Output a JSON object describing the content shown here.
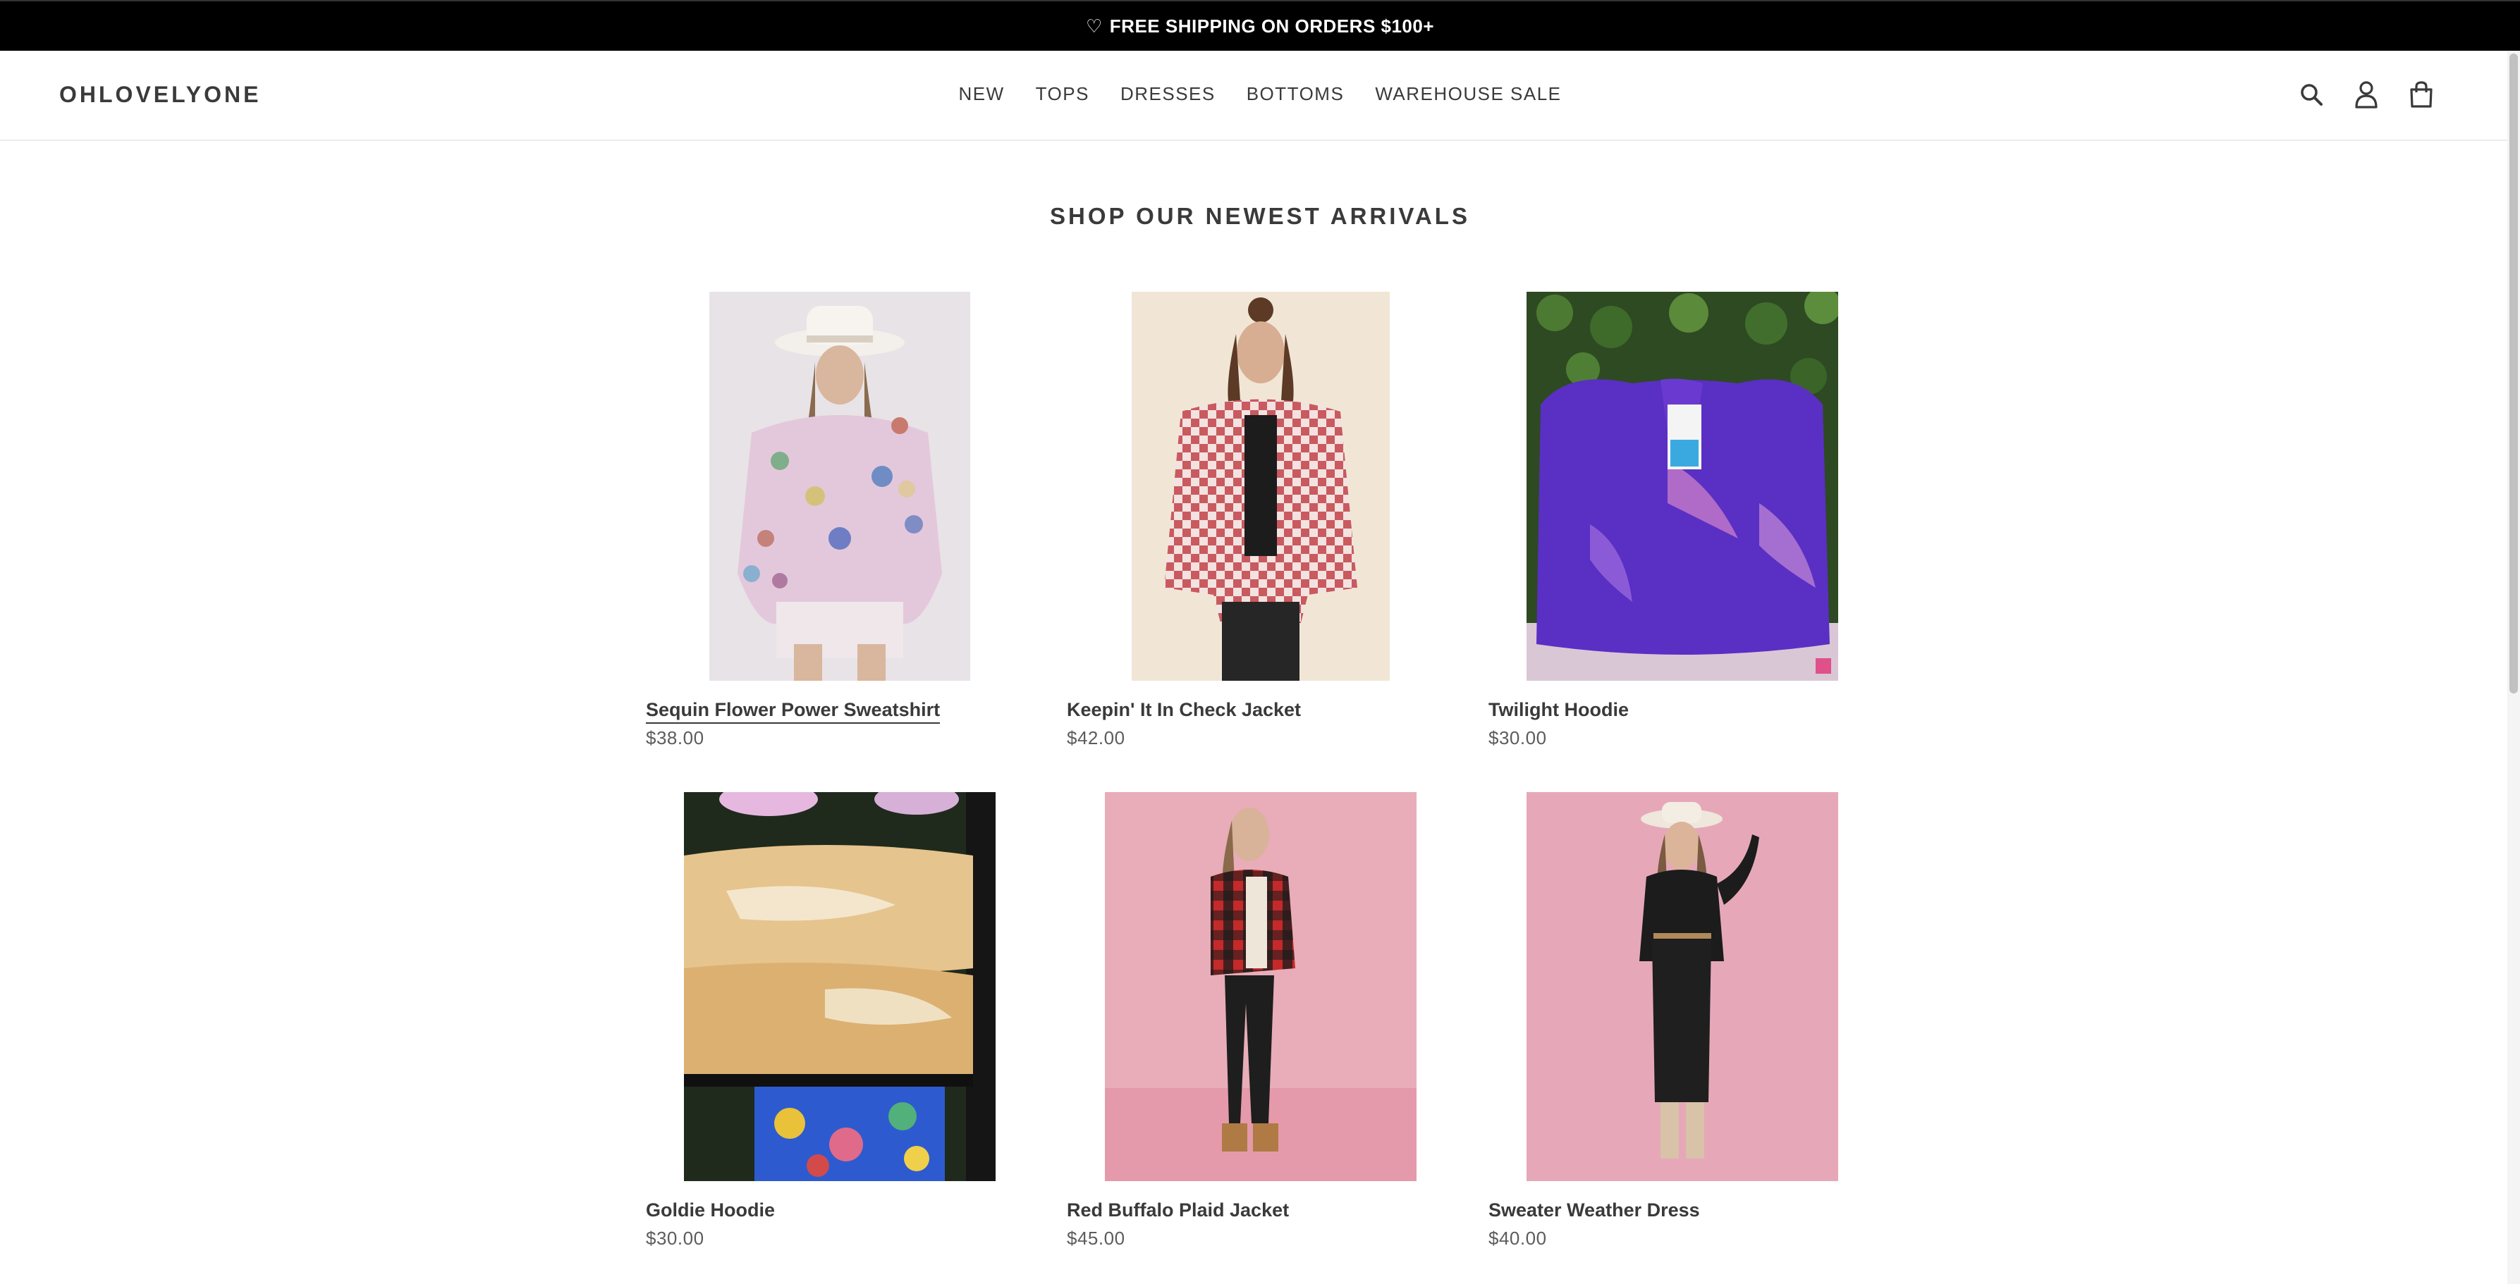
{
  "announcement": {
    "icon": "heart-icon",
    "text": "FREE SHIPPING ON ORDERS $100+"
  },
  "header": {
    "logo": "OHLOVELYONE",
    "nav": [
      "NEW",
      "TOPS",
      "DRESSES",
      "BOTTOMS",
      "WAREHOUSE SALE"
    ],
    "icons": [
      "search-icon",
      "account-icon",
      "cart-icon"
    ]
  },
  "section": {
    "title": "SHOP OUR NEWEST ARRIVALS"
  },
  "products": [
    {
      "name": "Sequin Flower Power Sweatshirt",
      "price": "$38.00"
    },
    {
      "name": "Keepin' It In Check Jacket",
      "price": "$42.00"
    },
    {
      "name": "Twilight Hoodie",
      "price": "$30.00"
    },
    {
      "name": "Goldie Hoodie",
      "price": "$30.00"
    },
    {
      "name": "Red Buffalo Plaid Jacket",
      "price": "$45.00"
    },
    {
      "name": "Sweater Weather Dress",
      "price": "$40.00"
    }
  ],
  "colors": {
    "announcement_bg": "#000000",
    "text": "#3a3a3a",
    "price": "#5c5c5c"
  }
}
